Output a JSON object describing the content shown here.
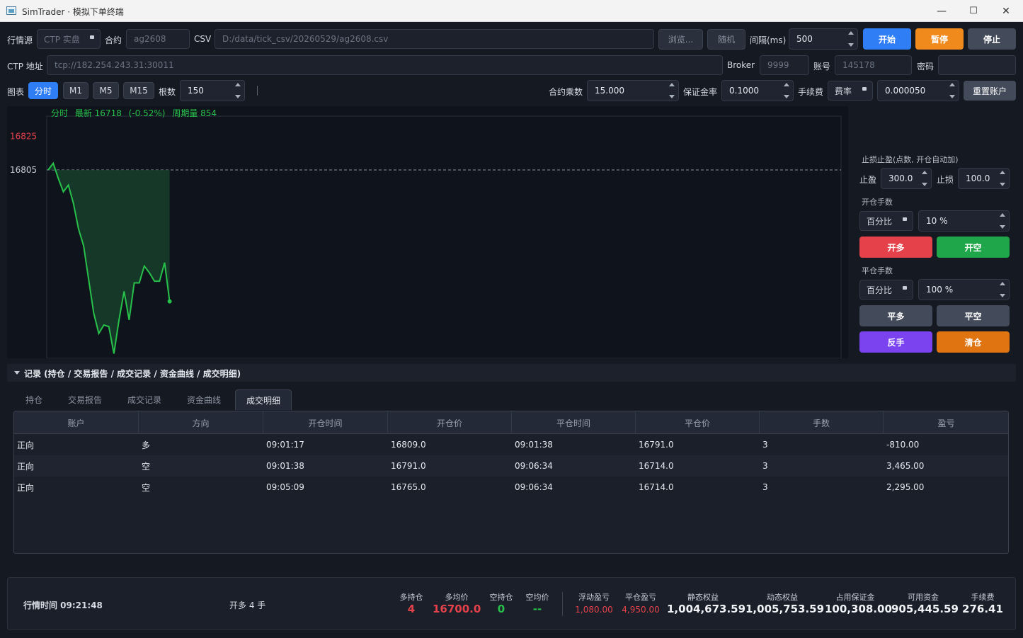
{
  "window": {
    "title": "SimTrader · 模拟下单终端",
    "min": "—",
    "max": "☐",
    "close": "✕"
  },
  "row1": {
    "source_label": "行情源",
    "source_value": "CTP 实盘",
    "contract_label": "合约",
    "contract_value": "ag2608",
    "csv_label": "CSV",
    "csv_path": "D:/data/tick_csv/20260529/ag2608.csv",
    "browse": "浏览...",
    "random": "随机",
    "interval_label": "间隔(ms)",
    "interval_value": "500",
    "start": "开始",
    "pause": "暂停",
    "stop": "停止"
  },
  "row2": {
    "ctp_label": "CTP 地址",
    "ctp_value": "tcp://182.254.243.31:30011",
    "broker_label": "Broker",
    "broker_value": "9999",
    "account_label": "账号",
    "account_value": "145178",
    "password_label": "密码",
    "password_value": ""
  },
  "row3": {
    "chart_label": "图表",
    "timeframes": [
      "分时",
      "M1",
      "M5",
      "M15"
    ],
    "bars_label": "根数",
    "bars_value": "150",
    "multiplier_label": "合约乘数",
    "multiplier_value": "15.000",
    "margin_label": "保证金率",
    "margin_value": "0.1000",
    "fee_label": "手续费",
    "fee_mode": "费率",
    "fee_value": "0.000050",
    "reset": "重置账户"
  },
  "chart": {
    "header": {
      "name": "分时",
      "latest": "最新 16718",
      "change": "(-0.52%)",
      "volume": "周期量 854"
    },
    "ytick_labels": [
      "16825",
      "16805"
    ],
    "ref_price": 16805,
    "prices": [
      16805,
      16809,
      16800,
      16792,
      16796,
      16785,
      16770,
      16760,
      16740,
      16720,
      16708,
      16713,
      16712,
      16696,
      16716,
      16733,
      16716,
      16738,
      16738,
      16748,
      16744,
      16739,
      16739,
      16750,
      16727
    ],
    "colors": {
      "line": "#27c04a",
      "fill": "#17402a",
      "up": "#e5414b",
      "tick": "#c8ced8",
      "header": "#27c04a"
    }
  },
  "side": {
    "sltp_title": "止损止盈(点数, 开仓自动加)",
    "tp_label": "止盈",
    "tp_value": "300.0",
    "sl_label": "止损",
    "sl_value": "100.0",
    "open_title": "开仓手数",
    "open_mode": "百分比",
    "open_value": "10 %",
    "open_long": "开多",
    "open_short": "开空",
    "close_title": "平仓手数",
    "close_mode": "百分比",
    "close_value": "100 %",
    "close_long": "平多",
    "close_short": "平空",
    "reverse": "反手",
    "flat": "清仓"
  },
  "records": {
    "title": "记录 (持仓 / 交易报告 / 成交记录 / 资金曲线 / 成交明细)",
    "tabs": [
      "持仓",
      "交易报告",
      "成交记录",
      "资金曲线",
      "成交明细"
    ],
    "columns": [
      "账户",
      "方向",
      "开仓时间",
      "开仓价",
      "平仓时间",
      "平仓价",
      "手数",
      "盈亏"
    ],
    "rows": [
      [
        "正向",
        "多",
        "09:01:17",
        "16809.0",
        "09:01:38",
        "16791.0",
        "3",
        "-810.00"
      ],
      [
        "正向",
        "空",
        "09:01:38",
        "16791.0",
        "09:06:34",
        "16714.0",
        "3",
        "3,465.00"
      ],
      [
        "正向",
        "空",
        "09:05:09",
        "16765.0",
        "09:06:34",
        "16714.0",
        "3",
        "2,295.00"
      ]
    ]
  },
  "status": {
    "market_time": "行情时间 09:21:48",
    "action": "开多 4 手",
    "long_pos_label": "多持仓",
    "long_pos": "4",
    "long_avg_label": "多均价",
    "long_avg": "16700.0",
    "short_pos_label": "空持仓",
    "short_pos": "0",
    "short_avg_label": "空均价",
    "short_avg": "--",
    "float_pnl_label": "浮动盈亏",
    "float_pnl": "1,080.00",
    "close_pnl_label": "平仓盈亏",
    "close_pnl": "4,950.00",
    "static_eq_label": "静态权益",
    "static_eq": "1,004,673.59",
    "dynamic_eq_label": "动态权益",
    "dynamic_eq": "1,005,753.59",
    "margin_used_label": "占用保证金",
    "margin_used": "100,308.00",
    "available_label": "可用资金",
    "available": "905,445.59",
    "fee_label": "手续费",
    "fee": "276.41"
  }
}
